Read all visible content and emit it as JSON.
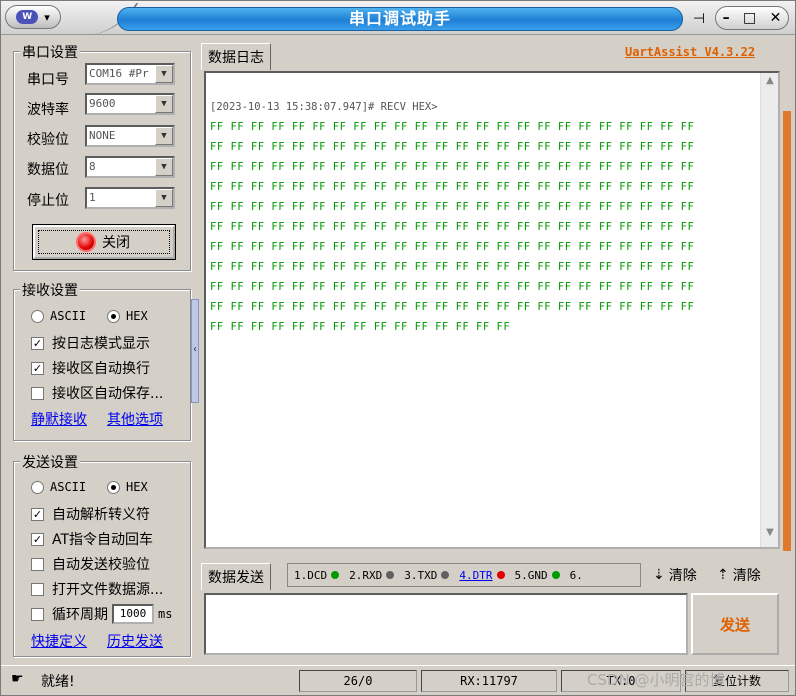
{
  "title": "串口调试助手",
  "version": "UartAssist V4.3.22",
  "window_controls": {
    "pin": "⊣",
    "minimize": "–",
    "maximize": "□",
    "close": "✕"
  },
  "serial": {
    "group": "串口设置",
    "port_label": "串口号",
    "port_value": "COM16 #Pr",
    "baud_label": "波特率",
    "baud_value": "9600",
    "parity_label": "校验位",
    "parity_value": "NONE",
    "data_label": "数据位",
    "data_value": "8",
    "stop_label": "停止位",
    "stop_value": "1",
    "close_button": "关闭"
  },
  "receive": {
    "group": "接收设置",
    "ascii": "ASCII",
    "hex": "HEX",
    "mode": "HEX",
    "opt1": "按日志模式显示",
    "opt1_checked": true,
    "opt2": "接收区自动换行",
    "opt2_checked": true,
    "opt3": "接收区自动保存...",
    "opt3_checked": false,
    "link1": "静默接收",
    "link2": "其他选项"
  },
  "send": {
    "group": "发送设置",
    "ascii": "ASCII",
    "hex": "HEX",
    "mode": "HEX",
    "opt1": "自动解析转义符",
    "opt1_checked": true,
    "opt2": "AT指令自动回车",
    "opt2_checked": true,
    "opt3": "自动发送校验位",
    "opt3_checked": false,
    "opt4": "打开文件数据源...",
    "opt4_checked": false,
    "opt5": "循环周期",
    "opt5_checked": false,
    "period": "1000",
    "period_unit": "ms",
    "link1": "快捷定义",
    "link2": "历史发送"
  },
  "log": {
    "tab": "数据日志",
    "header": "[2023-10-13 15:38:07.947]# RECV HEX>",
    "lines": [
      "FF FF FF FF FF FF FF FF FF FF FF FF FF FF FF FF FF FF FF FF FF FF FF FF",
      "FF FF FF FF FF FF FF FF FF FF FF FF FF FF FF FF FF FF FF FF FF FF FF FF",
      "FF FF FF FF FF FF FF FF FF FF FF FF FF FF FF FF FF FF FF FF FF FF FF FF",
      "FF FF FF FF FF FF FF FF FF FF FF FF FF FF FF FF FF FF FF FF FF FF FF FF",
      "FF FF FF FF FF FF FF FF FF FF FF FF FF FF FF FF FF FF FF FF FF FF FF FF",
      "FF FF FF FF FF FF FF FF FF FF FF FF FF FF FF FF FF FF FF FF FF FF FF FF",
      "FF FF FF FF FF FF FF FF FF FF FF FF FF FF FF FF FF FF FF FF FF FF FF FF",
      "FF FF FF FF FF FF FF FF FF FF FF FF FF FF FF FF FF FF FF FF FF FF FF FF",
      "FF FF FF FF FF FF FF FF FF FF FF FF FF FF FF FF FF FF FF FF FF FF FF FF",
      "FF FF FF FF FF FF FF FF FF FF FF FF FF FF FF FF FF FF FF FF FF FF FF FF",
      "FF FF FF FF FF FF FF FF FF FF FF FF FF FF FF"
    ]
  },
  "send_area": {
    "tab": "数据发送",
    "signals": [
      {
        "label": "1.DCD",
        "color": "#009900"
      },
      {
        "label": "2.RXD",
        "color": "#606060"
      },
      {
        "label": "3.TXD",
        "color": "#606060"
      },
      {
        "label": "4.DTR",
        "color": "#e00000"
      },
      {
        "label": "5.GND",
        "color": "#009900"
      },
      {
        "label": "6.",
        "color": ""
      }
    ],
    "clear1": "清除",
    "clear2": "清除",
    "send_button": "发送"
  },
  "status": {
    "ready": "就绪!",
    "count": "26/0",
    "rx": "RX:11797",
    "tx": "TX:0",
    "reset": "复位计数"
  },
  "watermark": "CSDN @小明宫的博"
}
